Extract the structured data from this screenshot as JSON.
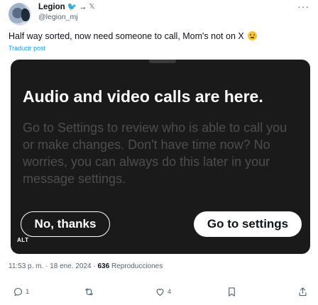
{
  "tweet": {
    "author": {
      "display_name": "Legion",
      "name_badges": [
        "🐦",
        "→",
        "𝕏"
      ],
      "handle": "@legion_mj"
    },
    "text": "Half way sorted, now need someone to call, Mom's not on X",
    "translate_label": "Traducir post"
  },
  "media": {
    "title": "Audio and video calls are here.",
    "body": "Go to Settings to review who is able to call you or make changes. Don't have time now? No worries, you can always do this later in your message settings.",
    "decline_button": "No, thanks",
    "settings_button": "Go to settings",
    "alt_badge": "ALT"
  },
  "meta": {
    "time": "11:53 p. m.",
    "separator": "·",
    "date": "18 ene. 2024",
    "views_count": "636",
    "views_label": "Reproducciones"
  },
  "actions": {
    "reply_count": "1",
    "retweet_count": "",
    "like_count": "4"
  },
  "icons": {
    "more": "more-icon",
    "reply": "reply-icon",
    "retweet": "retweet-icon",
    "like": "heart-icon",
    "bookmark": "bookmark-icon",
    "share": "share-icon"
  },
  "colors": {
    "link": "#1d9bf0",
    "secondary_text": "#536471",
    "media_background": "#1a1a1a"
  }
}
